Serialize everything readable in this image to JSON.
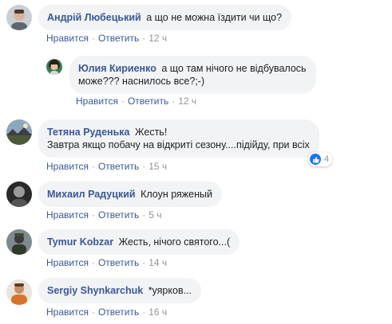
{
  "comments": [
    {
      "author": "Андрій Любецький",
      "text_lines": [
        "а що не можна їздити чи що?"
      ],
      "like_label": "Нравится",
      "reply_label": "Ответить",
      "separator": "·",
      "time": "12 ч",
      "avatar": "avatar-photo-man"
    },
    {
      "author": "Юлия Кириенко",
      "text_lines": [
        "а що там нічого не відбувалось",
        "може??? наснилось все?;-)"
      ],
      "like_label": "Нравится",
      "reply_label": "Ответить",
      "separator": "·",
      "time": "12 ч",
      "avatar": "avatar-photo-woman"
    },
    {
      "author": "Тетяна Руденька",
      "text_lines": [
        "Жесть!",
        "Завтра якщо побачу на відкриті сезону....підійду, при всіх"
      ],
      "like_label": "Нравится",
      "reply_label": "Ответить",
      "separator": "·",
      "time": "15 ч",
      "reaction_count": "4",
      "reaction_icon": "like-icon",
      "avatar": "avatar-photo-landscape"
    },
    {
      "author": "Михаил Радуцкий",
      "text_lines": [
        "Клоун ряженый"
      ],
      "like_label": "Нравится",
      "reply_label": "Ответить",
      "separator": "·",
      "time": "5 ч",
      "avatar": "avatar-photo-dark"
    },
    {
      "author": "Tymur Kobzar",
      "text_lines": [
        "Жесть, нічого святого...("
      ],
      "like_label": "Нравится",
      "reply_label": "Ответить",
      "separator": "·",
      "time": "14 ч",
      "avatar": "avatar-photo-soldier"
    },
    {
      "author": "Sergiy Shynkarchuk",
      "text_lines": [
        "*уярков..."
      ],
      "like_label": "Нравится",
      "reply_label": "Ответить",
      "separator": "·",
      "time": "16 ч",
      "avatar": "avatar-photo-man-orange"
    }
  ],
  "colors": {
    "bubble_bg": "#f2f3f5",
    "author": "#385898",
    "link": "#385898",
    "meta": "#90949c",
    "like_badge": "#1877f2"
  }
}
